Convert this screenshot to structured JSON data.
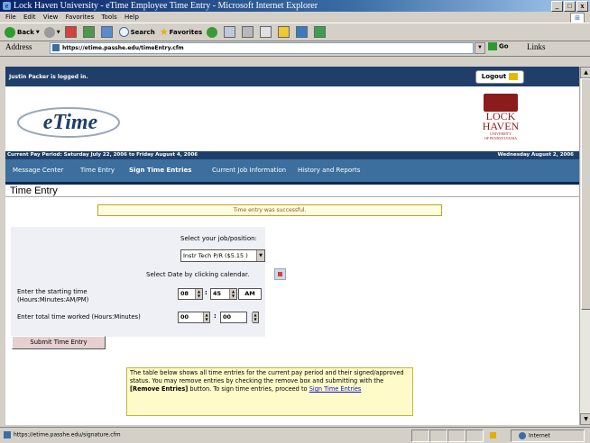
{
  "window": {
    "title": "Lock Haven University - eTime Employee Time Entry - Microsoft Internet Explorer",
    "controls": [
      "_",
      "□",
      "x"
    ]
  },
  "menu": [
    "File",
    "Edit",
    "View",
    "Favorites",
    "Tools",
    "Help"
  ],
  "toolbar": {
    "back": "Back",
    "search": "Search",
    "favorites": "Favorites"
  },
  "address": {
    "label": "Address",
    "url": "https://etime.passhe.edu/timeEntry.cfm",
    "go": "Go",
    "links": "Links"
  },
  "page": {
    "logged_in": "Justin Packer is logged in.",
    "logout": "Logout",
    "logo_text": "eTime",
    "university": {
      "line1": "LOCK",
      "line2": "HAVEN",
      "line3": "UNIVERSITY",
      "line4": "OF PENNSYLVANIA"
    },
    "pay_period": "Current Pay Period: Saturday July 22, 2006 to Friday August 4, 2006",
    "current_date": "Wednesday August 2, 2006",
    "nav": [
      {
        "label": "Message Center",
        "active": false
      },
      {
        "label": "Time Entry",
        "active": false
      },
      {
        "label": "Sign Time Entries",
        "active": true
      },
      {
        "label": "Current Job Information",
        "active": false
      },
      {
        "label": "History and Reports",
        "active": false
      }
    ],
    "heading": "Time Entry",
    "success_message": "Time entry was successful.",
    "select_job_label": "Select your job/position:",
    "job_value": "Instr Tech P/R ($5.15 )",
    "select_date_label": "Select Date by clicking calendar.",
    "start_label_1": "Enter the starting time",
    "start_label_2": "(Hours:Minutes:AM/PM)",
    "start_hours": "08",
    "start_minutes": "45",
    "start_ampm": "AM",
    "total_label": "Enter total time worked (Hours:Minutes)",
    "total_hours": "00",
    "total_minutes": "00",
    "submit": "Submit Time Entry",
    "info_text_1": "The table below shows all time entries for the current pay period and their signed/approved status. You may remove entries by checking the remove box and submitting with the ",
    "info_bold": "[Remove Entries]",
    "info_text_2": " button. To sign time entries, proceed to ",
    "info_link": "Sign Time Entries"
  },
  "status": {
    "url": "https://etime.passhe.edu/signature.cfm",
    "zone": "Internet"
  },
  "colors": {
    "header_navy": "#1f3f6a",
    "nav_blue": "#3c6e9e",
    "success_bg": "#fffde0",
    "info_bg": "#fefbc8"
  }
}
